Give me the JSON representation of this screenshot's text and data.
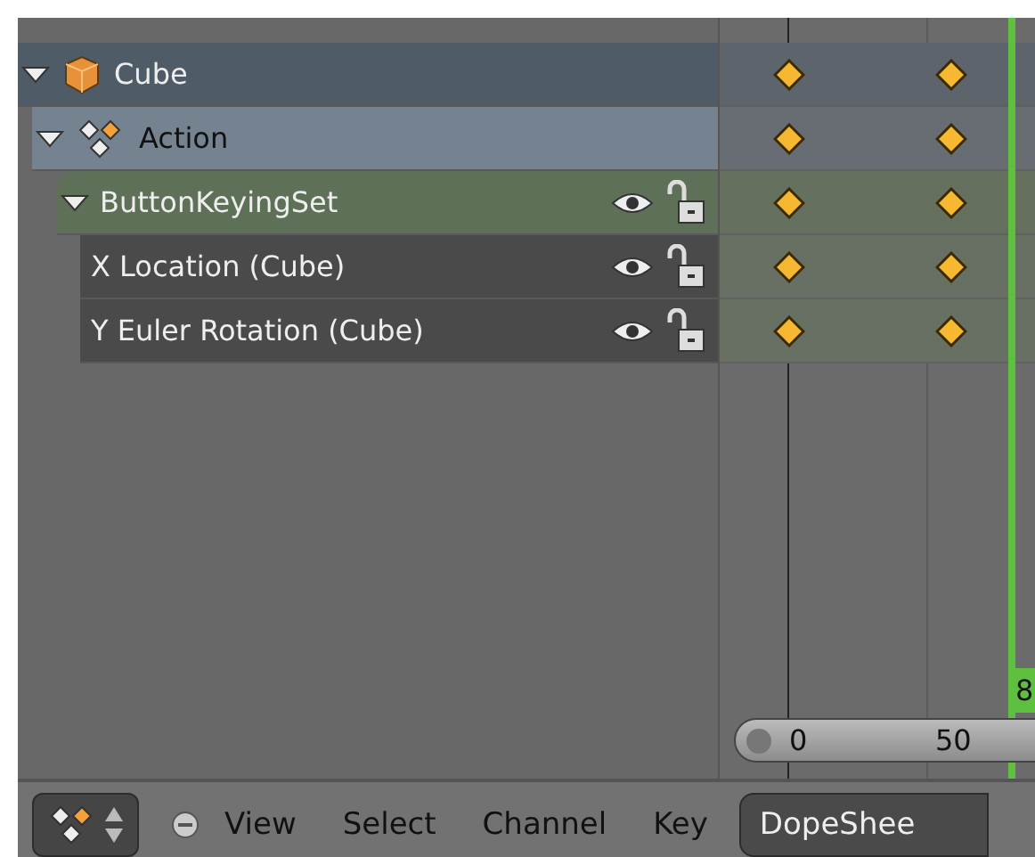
{
  "channels": [
    {
      "kind": "object",
      "name": "Cube",
      "expanded": true
    },
    {
      "kind": "action",
      "name": "Action",
      "expanded": true
    },
    {
      "kind": "group",
      "name": "ButtonKeyingSet",
      "expanded": true,
      "visible": true,
      "locked": false
    },
    {
      "kind": "fcurve",
      "name": "X Location (Cube)",
      "visible": true,
      "locked": false
    },
    {
      "kind": "fcurve",
      "name": "Y Euler Rotation (Cube)",
      "visible": true,
      "locked": false
    }
  ],
  "timeline": {
    "ruler": [
      "0",
      "50"
    ],
    "current_frame": "8"
  },
  "header": {
    "menus": [
      "View",
      "Select",
      "Channel",
      "Key"
    ],
    "mode": "DopeShee"
  }
}
